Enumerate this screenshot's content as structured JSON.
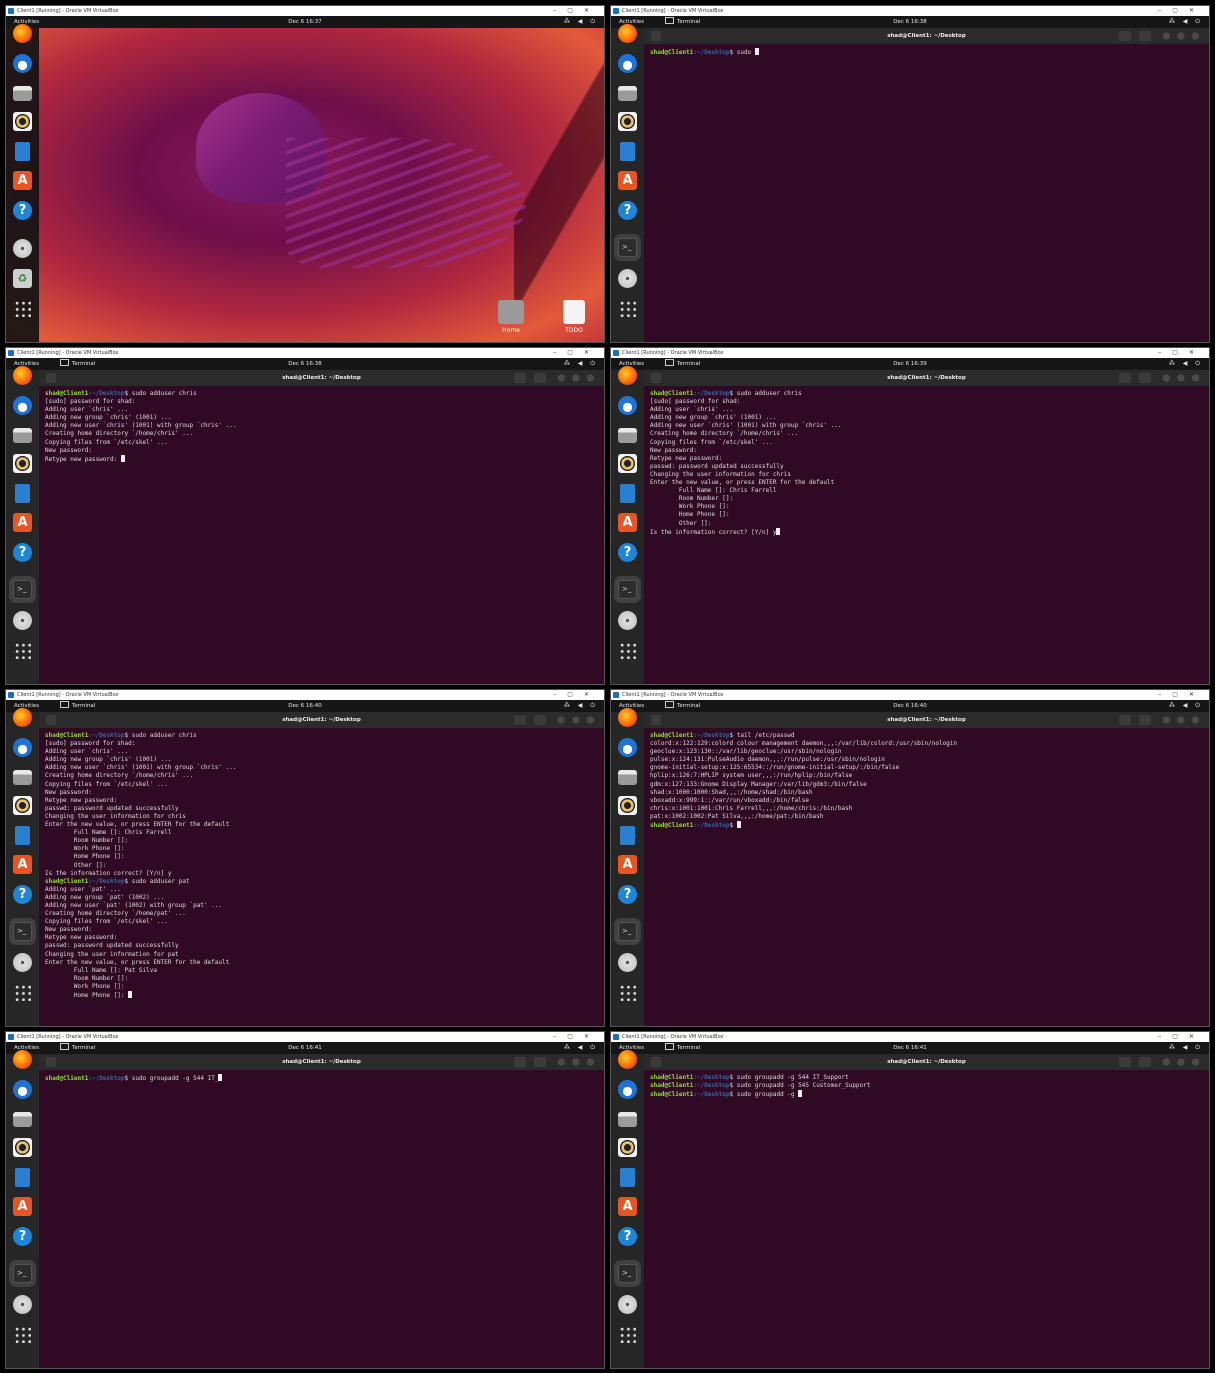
{
  "window_title": "Client1 [Running] - Oracle VM VirtualBox",
  "activities": "Activities",
  "app_name": "Terminal",
  "term_title": "shad@Client1: ~/Desktop",
  "prompt_user": "shad@Client1",
  "prompt_path": ":~/Desktop",
  "prompt_sym": "$ ",
  "desktop_icons": {
    "home": "Home",
    "todo": "TODO"
  },
  "panels": [
    {
      "clock": "Dec 6  16:37",
      "type": "desktop"
    },
    {
      "clock": "Dec 6  16:38",
      "type": "terminal",
      "lines": [
        {
          "cmd": "sudo ",
          "cursor": true
        }
      ]
    },
    {
      "clock": "Dec 6  16:38",
      "type": "terminal",
      "lines": [
        {
          "cmd": "sudo adduser chris"
        },
        {
          "text": "[sudo] password for shad:"
        },
        {
          "text": "Adding user `chris' ..."
        },
        {
          "text": "Adding new group `chris' (1001) ..."
        },
        {
          "text": "Adding new user `chris' (1001) with group `chris' ..."
        },
        {
          "text": "Creating home directory `/home/chris' ..."
        },
        {
          "text": "Copying files from `/etc/skel' ..."
        },
        {
          "text": "New password:"
        },
        {
          "text": "Retype new password: ",
          "cursor": true
        }
      ]
    },
    {
      "clock": "Dec 6  16:39",
      "type": "terminal",
      "lines": [
        {
          "cmd": "sudo adduser chris"
        },
        {
          "text": "[sudo] password for shad:"
        },
        {
          "text": "Adding user `chris' ..."
        },
        {
          "text": "Adding new group `chris' (1001) ..."
        },
        {
          "text": "Adding new user `chris' (1001) with group `chris' ..."
        },
        {
          "text": "Creating home directory `/home/chris' ..."
        },
        {
          "text": "Copying files from `/etc/skel' ..."
        },
        {
          "text": "New password:"
        },
        {
          "text": "Retype new password:"
        },
        {
          "text": "passwd: password updated successfully"
        },
        {
          "text": "Changing the user information for chris"
        },
        {
          "text": "Enter the new value, or press ENTER for the default"
        },
        {
          "text": "        Full Name []: Chris Farrell"
        },
        {
          "text": "        Room Number []:"
        },
        {
          "text": "        Work Phone []:"
        },
        {
          "text": "        Home Phone []:"
        },
        {
          "text": "        Other []:"
        },
        {
          "text": "Is the information correct? [Y/n] y",
          "cursor": true
        }
      ]
    },
    {
      "clock": "Dec 6  16:40",
      "type": "terminal",
      "lines": [
        {
          "cmd": "sudo adduser chris"
        },
        {
          "text": "[sudo] password for shad:"
        },
        {
          "text": "Adding user `chris' ..."
        },
        {
          "text": "Adding new group `chris' (1001) ..."
        },
        {
          "text": "Adding new user `chris' (1001) with group `chris' ..."
        },
        {
          "text": "Creating home directory `/home/chris' ..."
        },
        {
          "text": "Copying files from `/etc/skel' ..."
        },
        {
          "text": "New password:"
        },
        {
          "text": "Retype new password:"
        },
        {
          "text": "passwd: password updated successfully"
        },
        {
          "text": "Changing the user information for chris"
        },
        {
          "text": "Enter the new value, or press ENTER for the default"
        },
        {
          "text": "        Full Name []: Chris Farrell"
        },
        {
          "text": "        Room Number []:"
        },
        {
          "text": "        Work Phone []:"
        },
        {
          "text": "        Home Phone []:"
        },
        {
          "text": "        Other []:"
        },
        {
          "text": "Is the information correct? [Y/n] y"
        },
        {
          "cmd": "sudo adduser pat"
        },
        {
          "text": "Adding user `pat' ..."
        },
        {
          "text": "Adding new group `pat' (1002) ..."
        },
        {
          "text": "Adding new user `pat' (1002) with group `pat' ..."
        },
        {
          "text": "Creating home directory `/home/pat' ..."
        },
        {
          "text": "Copying files from `/etc/skel' ..."
        },
        {
          "text": "New password:"
        },
        {
          "text": "Retype new password:"
        },
        {
          "text": "passwd: password updated successfully"
        },
        {
          "text": "Changing the user information for pat"
        },
        {
          "text": "Enter the new value, or press ENTER for the default"
        },
        {
          "text": "        Full Name []: Pat Silva"
        },
        {
          "text": "        Room Number []:"
        },
        {
          "text": "        Work Phone []:"
        },
        {
          "text": "        Home Phone []: ",
          "cursor": true
        }
      ]
    },
    {
      "clock": "Dec 6  16:40",
      "type": "terminal",
      "lines": [
        {
          "cmd": "tail /etc/passwd"
        },
        {
          "text": "colord:x:122:129:colord colour management daemon,,,:/var/lib/colord:/usr/sbin/nologin"
        },
        {
          "text": "geoclue:x:123:130::/var/lib/geoclue:/usr/sbin/nologin"
        },
        {
          "text": "pulse:x:124:131:PulseAudio daemon,,,:/run/pulse:/usr/sbin/nologin"
        },
        {
          "text": "gnome-initial-setup:x:125:65534::/run/gnome-initial-setup/:/bin/false"
        },
        {
          "text": "hplip:x:126:7:HPLIP system user,,,:/run/hplip:/bin/false"
        },
        {
          "text": "gdm:x:127:133:Gnome Display Manager:/var/lib/gdm3:/bin/false"
        },
        {
          "text": "shad:x:1000:1000:Shad,,,:/home/shad:/bin/bash"
        },
        {
          "text": "vboxadd:x:999:1::/var/run/vboxadd:/bin/false"
        },
        {
          "text": "chris:x:1001:1001:Chris Farrell,,,:/home/chris:/bin/bash"
        },
        {
          "text": "pat:x:1002:1002:Pat Silva,,,:/home/pat:/bin/bash"
        },
        {
          "cmd": "",
          "cursor": true
        }
      ]
    },
    {
      "clock": "Dec 6  16:41",
      "type": "terminal",
      "lines": [
        {
          "cmd": "sudo groupadd -g 544 IT_",
          "cursor": true
        }
      ]
    },
    {
      "clock": "Dec 6  16:41",
      "type": "terminal",
      "lines": [
        {
          "cmd": "sudo groupadd -g 544 IT_Support"
        },
        {
          "cmd": "sudo groupadd -g 545 Customer_Support"
        },
        {
          "cmd": "sudo groupadd -g ",
          "cursor": true
        }
      ]
    }
  ],
  "dock_icons": [
    "firefox-icon",
    "thunderbird-icon",
    "files-icon",
    "rhythmbox-icon",
    "writer-icon",
    "app-center-icon",
    "help-icon",
    "terminal-icon",
    "disc-icon",
    "trash-icon",
    "app-grid-icon"
  ]
}
